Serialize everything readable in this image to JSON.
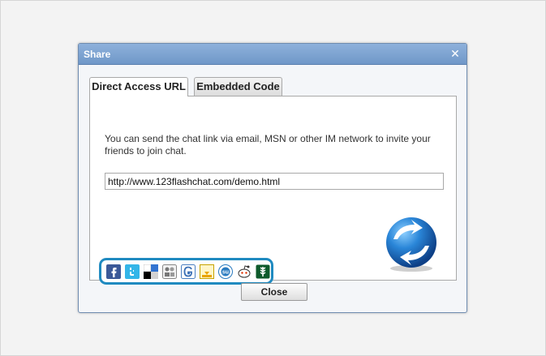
{
  "dialog": {
    "title": "Share",
    "close_glyph": "✕"
  },
  "tabs": [
    {
      "label": "Direct Access URL",
      "active": true
    },
    {
      "label": "Embedded Code",
      "active": false
    }
  ],
  "panel": {
    "description": "You can send the chat link via email, MSN or other IM network to invite your friends to join chat.",
    "url_value": "http://www.123flashchat.com/demo.html"
  },
  "share_icons": [
    "facebook-icon",
    "twitter-icon",
    "delicious-icon",
    "myspace-icon",
    "google-icon",
    "digg-icon",
    "stumbleupon-icon",
    "reddit-icon",
    "newsvine-icon"
  ],
  "buttons": {
    "close_label": "Close"
  },
  "colors": {
    "title_bar": "#7aa2d4",
    "share_bar_border": "#1f8ac0"
  }
}
